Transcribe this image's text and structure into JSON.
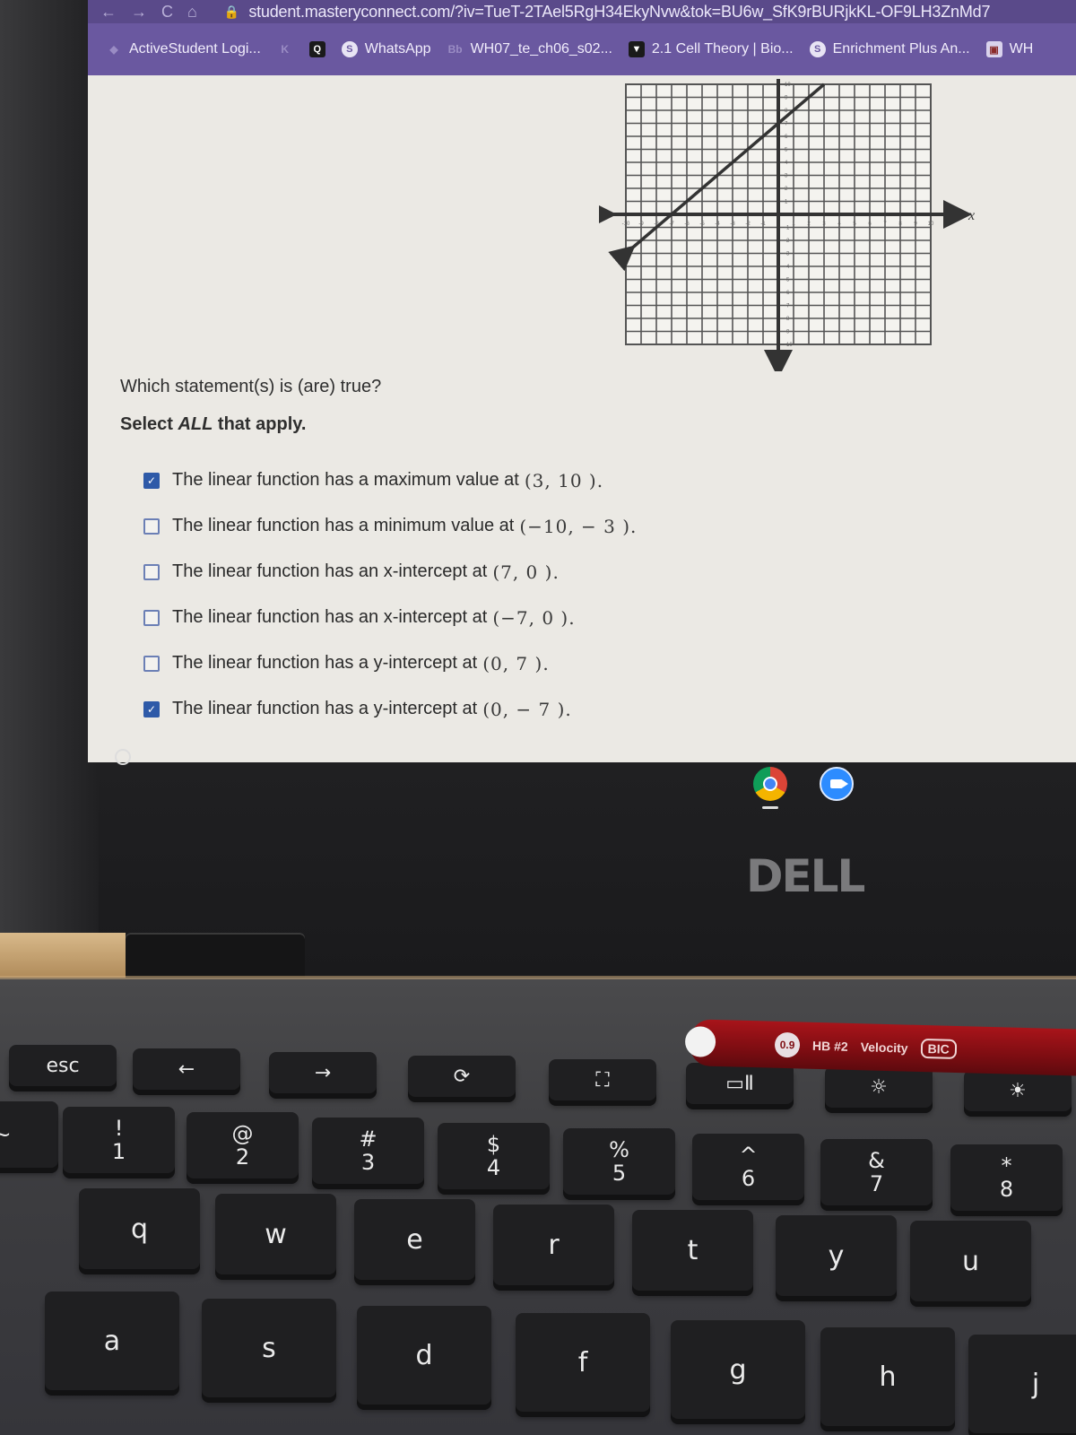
{
  "browser": {
    "nav": {
      "back": "←",
      "forward": "→",
      "reload": "C",
      "home": "⌂"
    },
    "url": "student.masteryconnect.com/?iv=TueT-2TAel5RgH34EkyNvw&tok=BU6w_SfK9rBURjkKL-OF9LH3ZnMd7",
    "bookmarks": [
      {
        "label": "ActiveStudent Logi...",
        "icon": "globe-icon",
        "glyph": "◆"
      },
      {
        "label": "",
        "icon": "k-icon",
        "glyph": "K"
      },
      {
        "label": "",
        "icon": "q-icon",
        "glyph": "Q"
      },
      {
        "label": "WhatsApp",
        "icon": "whatsapp-icon",
        "glyph": "S"
      },
      {
        "label": "WH07_te_ch06_s02...",
        "icon": "bb-icon",
        "glyph": "Bb"
      },
      {
        "label": "2.1 Cell Theory | Bio...",
        "icon": "shield-icon",
        "glyph": "▼"
      },
      {
        "label": "Enrichment Plus An...",
        "icon": "whatsapp-icon",
        "glyph": "S"
      },
      {
        "label": "WH",
        "icon": "photo-icon",
        "glyph": "▣"
      }
    ]
  },
  "question": {
    "prompt": "Which statement(s) is (are) true?",
    "instruction_pre": "Select ",
    "instruction_em": "ALL",
    "instruction_post": " that apply.",
    "options": [
      {
        "text": "The linear function has a maximum value at",
        "math": "(3,  10 ).",
        "checked": true
      },
      {
        "text": "The linear function has a minimum value at",
        "math": "(−10,  − 3  ).",
        "checked": false
      },
      {
        "text": "The linear function has an x-intercept at",
        "math": "(7,  0 ).",
        "checked": false
      },
      {
        "text": "The linear function has an x-intercept at",
        "math": "(−7,  0 ).",
        "checked": false
      },
      {
        "text": "The linear function has a y-intercept at",
        "math": "(0,  7 ).",
        "checked": false
      },
      {
        "text": "The linear function has a y-intercept at",
        "math": "(0,  − 7 ).",
        "checked": true
      }
    ]
  },
  "chart_data": {
    "type": "line",
    "title": "",
    "xlabel": "x",
    "ylabel": "",
    "xlim": [
      -10,
      10
    ],
    "ylim": [
      -10,
      10
    ],
    "grid": true,
    "x_ticks": [
      -10,
      -9,
      -8,
      -7,
      -6,
      -5,
      -4,
      -3,
      -2,
      -1,
      1,
      2,
      3,
      4,
      5,
      6,
      7,
      8,
      9,
      10
    ],
    "y_ticks": [
      -10,
      -9,
      -8,
      -7,
      -6,
      -5,
      -4,
      -3,
      -2,
      -1,
      1,
      2,
      3,
      4,
      5,
      6,
      7,
      8,
      9,
      10
    ],
    "series": [
      {
        "name": "linear function",
        "x": [
          -10,
          3
        ],
        "y": [
          -3,
          10
        ],
        "arrows": "both"
      }
    ]
  },
  "shelf": [
    {
      "name": "chrome",
      "icon": "chrome-icon"
    },
    {
      "name": "zoom",
      "icon": "zoom-icon"
    }
  ],
  "brand": "DELL",
  "pencil": {
    "lead": "0.9",
    "grade": "HB #2",
    "model": "Velocity",
    "brand": "BIC"
  },
  "keyboard": {
    "row_fn": [
      {
        "label": "esc"
      },
      {
        "label": "←"
      },
      {
        "label": "→"
      },
      {
        "label": "⟳"
      },
      {
        "label": "⛶"
      },
      {
        "label": "▭Ⅱ"
      },
      {
        "label": "☼"
      },
      {
        "label": "☀"
      }
    ],
    "row_num": [
      {
        "top": "",
        "bot": "~"
      },
      {
        "top": "!",
        "bot": "1"
      },
      {
        "top": "@",
        "bot": "2"
      },
      {
        "top": "#",
        "bot": "3"
      },
      {
        "top": "$",
        "bot": "4"
      },
      {
        "top": "%",
        "bot": "5"
      },
      {
        "top": "^",
        "bot": "6"
      },
      {
        "top": "&",
        "bot": "7"
      },
      {
        "top": "*",
        "bot": "8"
      }
    ],
    "row_q": [
      "q",
      "w",
      "e",
      "r",
      "t",
      "y",
      "u"
    ],
    "row_a": [
      "a",
      "s",
      "d",
      "f",
      "g",
      "h",
      "j"
    ]
  }
}
